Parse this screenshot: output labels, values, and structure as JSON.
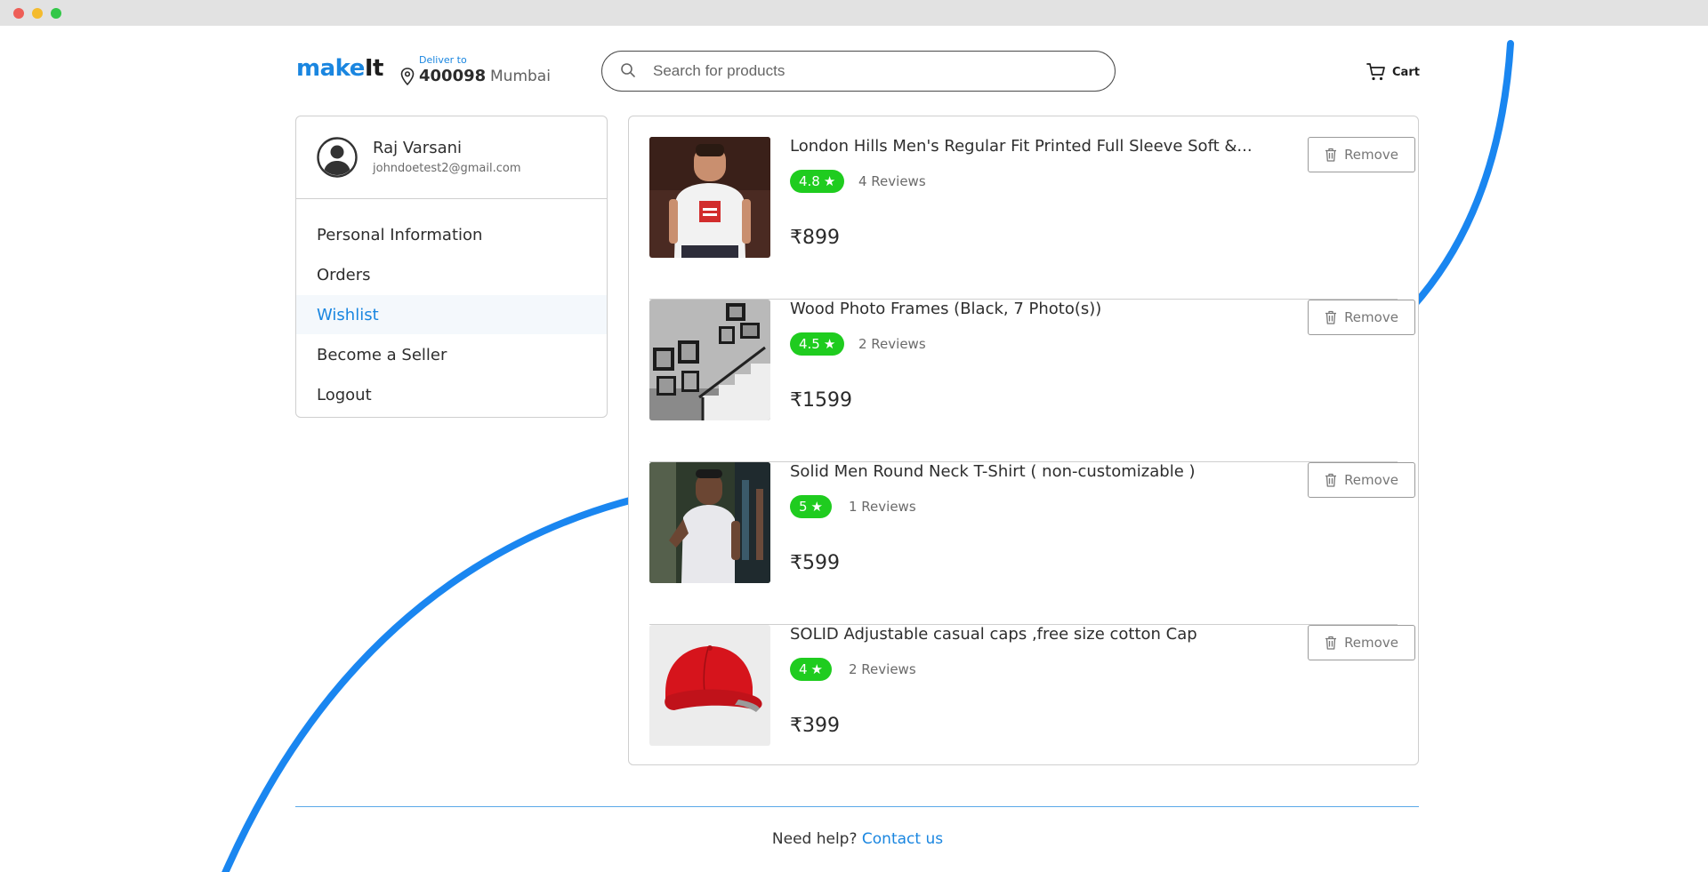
{
  "header": {
    "logo_make": "make",
    "logo_it": "It",
    "deliver_label": "Deliver to",
    "pincode": "400098",
    "city": "Mumbai",
    "search_placeholder": "Search for products",
    "cart_label": "Cart"
  },
  "profile": {
    "name": "Raj Varsani",
    "email": "johndoetest2@gmail.com"
  },
  "menu": {
    "items": [
      {
        "label": "Personal Information",
        "active": false
      },
      {
        "label": "Orders",
        "active": false
      },
      {
        "label": "Wishlist",
        "active": true
      },
      {
        "label": "Become a Seller",
        "active": false
      },
      {
        "label": "Logout",
        "active": false
      }
    ]
  },
  "wishlist": {
    "remove_label": "Remove",
    "items": [
      {
        "title": "London Hills Men's Regular Fit Printed Full Sleeve Soft &...",
        "rating": "4.8",
        "reviews": "4 Reviews",
        "price": "₹899",
        "image": "white-tshirt-man"
      },
      {
        "title": "Wood Photo Frames (Black, 7 Photo(s))",
        "rating": "4.5",
        "reviews": "2 Reviews",
        "price": "₹1599",
        "image": "photo-frames-staircase"
      },
      {
        "title": "Solid Men Round Neck T-Shirt ( non-customizable )",
        "rating": "5",
        "reviews": "1 Reviews",
        "price": "₹599",
        "image": "white-tee-man-standing"
      },
      {
        "title": "SOLID Adjustable casual caps ,free size cotton Cap",
        "rating": "4",
        "reviews": "2 Reviews",
        "price": "₹399",
        "image": "red-cap"
      }
    ]
  },
  "footer": {
    "help_text": "Need help?",
    "contact_label": "Contact us"
  },
  "colors": {
    "accent": "#1a86e0",
    "rating_badge": "#1fcc1f",
    "arc": "#1a86f0"
  }
}
